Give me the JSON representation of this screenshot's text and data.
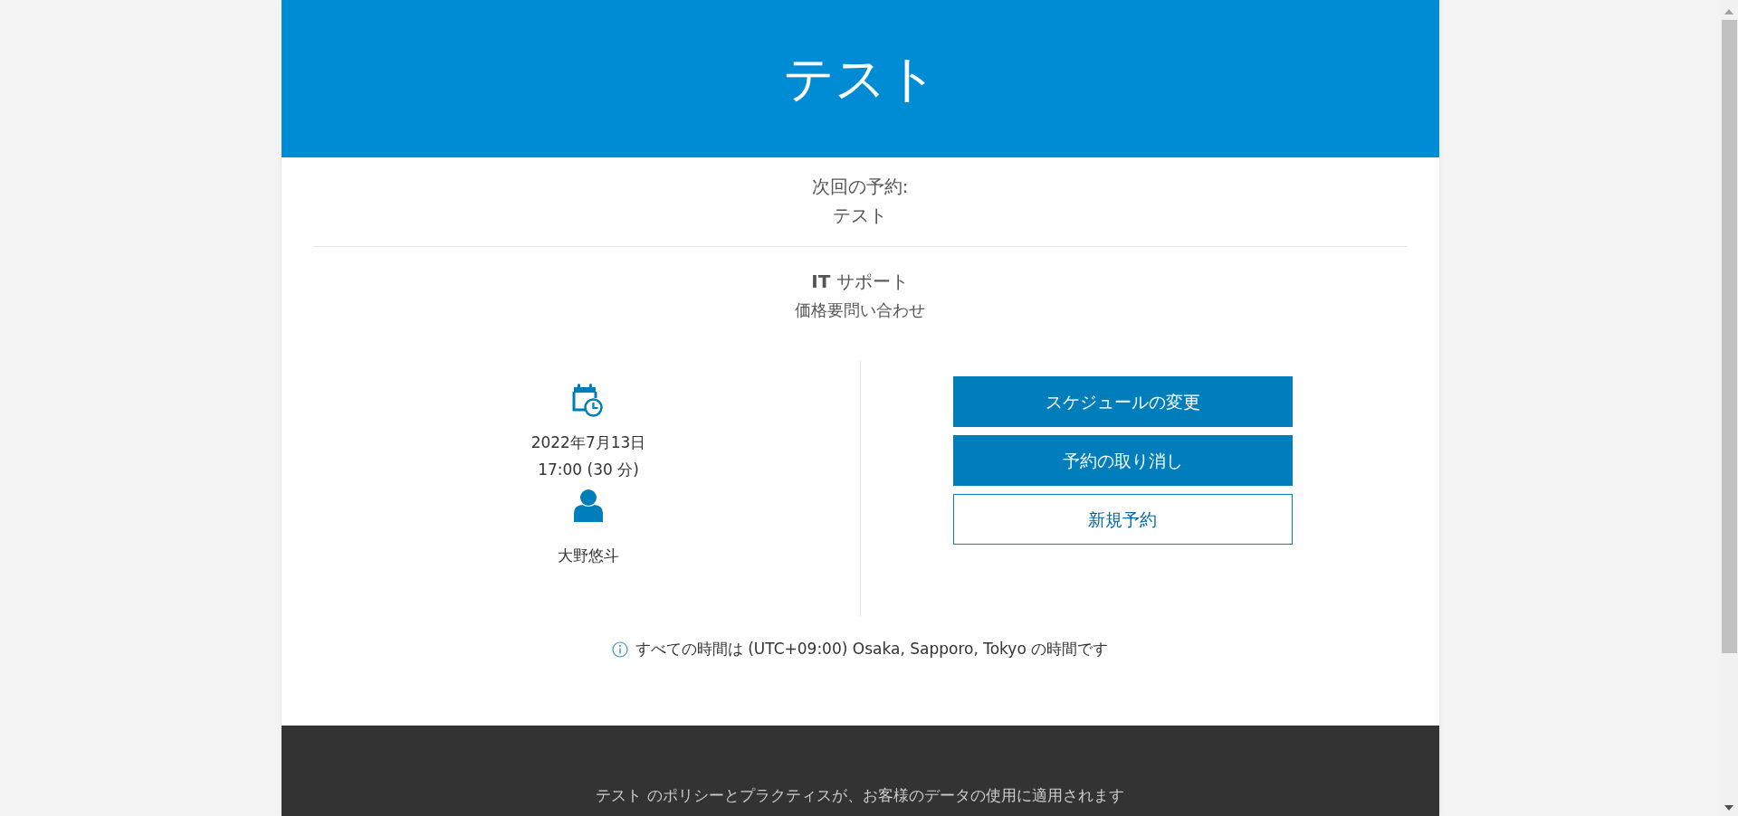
{
  "header": {
    "title": "テスト"
  },
  "next_booking": {
    "label": "次回の予約:",
    "name": "テスト"
  },
  "service": {
    "title": "**IT** サポート",
    "price": "価格要問い合わせ"
  },
  "details": {
    "date": "2022年7月13日",
    "time": "17:00 (30 分)",
    "staff": "大野悠斗"
  },
  "buttons": [
    {
      "label": "スケジュールの変更",
      "kind": "primary"
    },
    {
      "label": "予約の取り消し",
      "kind": "primary"
    },
    {
      "label": "新規予約",
      "kind": "outline"
    }
  ],
  "timezone_note": "すべての時間は (UTC+09:00) Osaka, Sapporo, Tokyo の時間です",
  "footer": {
    "text": "テスト のポリシーとプラクティスが、お客様のデータの使用に適用されます"
  }
}
